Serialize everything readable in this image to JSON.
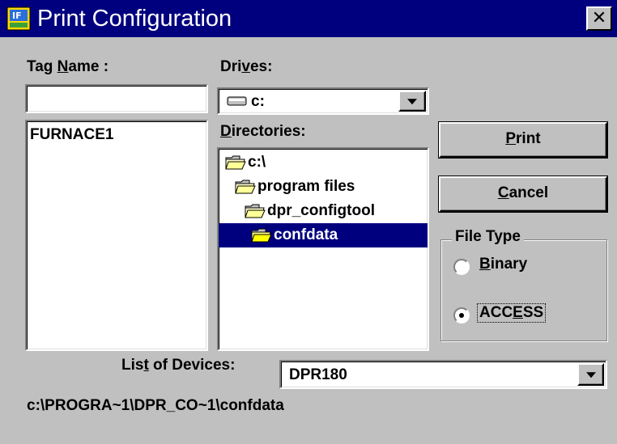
{
  "window": {
    "title": "Print Configuration",
    "close_label": "✕"
  },
  "tag_name": {
    "label_pre": "Tag ",
    "label_mnemonic": "N",
    "label_post": "ame :",
    "value": "",
    "list": [
      "FURNACE1"
    ]
  },
  "drives": {
    "label_pre": "Dri",
    "label_mnemonic": "v",
    "label_post": "es:",
    "value": "c:"
  },
  "directories": {
    "label_pre": "",
    "label_mnemonic": "D",
    "label_post": "irectories:",
    "items": [
      {
        "label": "c:\\",
        "open": true,
        "selected": false
      },
      {
        "label": "program files",
        "open": true,
        "selected": false
      },
      {
        "label": "dpr_configtool",
        "open": true,
        "selected": false
      },
      {
        "label": "confdata",
        "open": true,
        "selected": true
      }
    ]
  },
  "buttons": {
    "print_mnemonic": "P",
    "print_rest": "rint",
    "cancel_mnemonic": "C",
    "cancel_rest": "ancel"
  },
  "file_type": {
    "legend": "File Type",
    "options": [
      {
        "pre": "",
        "mnemonic": "B",
        "post": "inary",
        "selected": false
      },
      {
        "pre": "ACC",
        "mnemonic": "E",
        "post": "SS",
        "selected": true
      }
    ]
  },
  "devices": {
    "label_pre": "Lis",
    "label_mnemonic": "t",
    "label_post": " of Devices:",
    "value": "DPR180"
  },
  "path": "c:\\PROGRA~1\\DPR_CO~1\\confdata",
  "colors": {
    "titlebar": "#00007f",
    "selection": "#00007f",
    "face": "#c0c0c0"
  }
}
